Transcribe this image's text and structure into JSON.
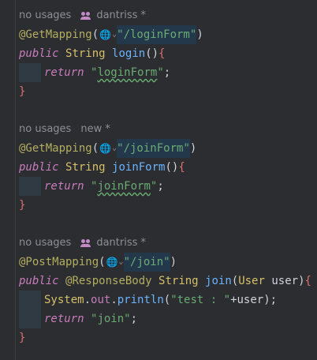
{
  "blocks": [
    {
      "hint": {
        "usages": "no usages",
        "author": "dantriss *",
        "show_icon": true
      },
      "annotation": "@GetMapping",
      "path": "/loginForm",
      "signature": {
        "modifier": "public",
        "type": "String",
        "name": "login",
        "params": "()"
      },
      "body": [
        {
          "kind": "return",
          "keyword": "return",
          "value": "loginForm"
        }
      ],
      "close": "}"
    },
    {
      "hint": {
        "usages": "no usages",
        "author": "new *",
        "show_icon": false
      },
      "annotation": "@GetMapping",
      "path": "/joinForm",
      "signature": {
        "modifier": "public",
        "type": "String",
        "name": "joinForm",
        "params": "()"
      },
      "body": [
        {
          "kind": "return",
          "keyword": "return",
          "value": "joinForm"
        }
      ],
      "close": "}"
    },
    {
      "hint": {
        "usages": "no usages",
        "author": "dantriss *",
        "show_icon": true
      },
      "annotation": "@PostMapping",
      "path": "/join",
      "signature": {
        "modifier": "public",
        "extra_annotation": "@ResponseBody",
        "type": "String",
        "name": "join",
        "param_type": "User",
        "param_name": "user"
      },
      "body": [
        {
          "kind": "println",
          "obj": "System",
          "field": "out",
          "method": "println",
          "arg": "\"test : \"",
          "concat": "+user"
        },
        {
          "kind": "return",
          "keyword": "return",
          "value": "join"
        }
      ],
      "close": "}"
    }
  ],
  "icons": {
    "author": "users-icon",
    "route": "globe-icon"
  }
}
